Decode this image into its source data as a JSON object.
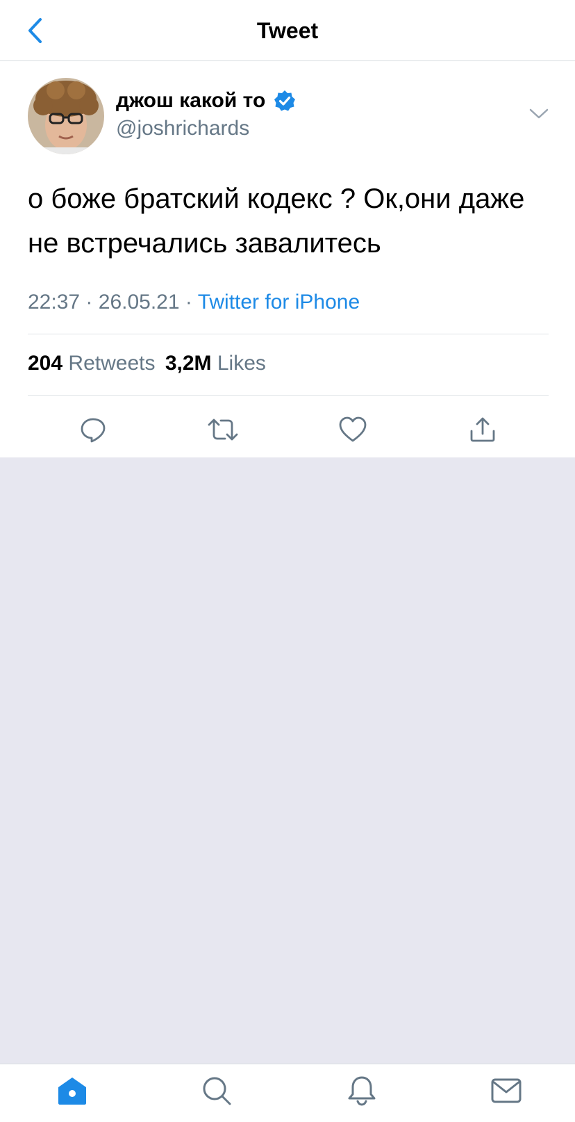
{
  "header": {
    "title": "Tweet",
    "back_icon": "chevron-left-icon"
  },
  "tweet": {
    "author": {
      "display_name": "джош какой то",
      "handle": "@joshrichards",
      "verified": true
    },
    "text": "о боже братский кодекс ? Ок,они даже не встречались завалитесь",
    "time": "22:37",
    "date": "26.05.21",
    "separator": "·",
    "source": "Twitter for iPhone",
    "stats": {
      "retweets_count": "204",
      "retweets_label": "Retweets",
      "likes_count": "3,2M",
      "likes_label": "Likes"
    },
    "actions": [
      "reply-icon",
      "retweet-icon",
      "like-icon",
      "share-icon"
    ]
  },
  "tabbar": {
    "tabs": [
      "home-icon",
      "search-icon",
      "notifications-icon",
      "messages-icon"
    ]
  },
  "colors": {
    "accent": "#1d8ae6",
    "secondary_text": "#657786",
    "background": "#e7e7f0"
  }
}
